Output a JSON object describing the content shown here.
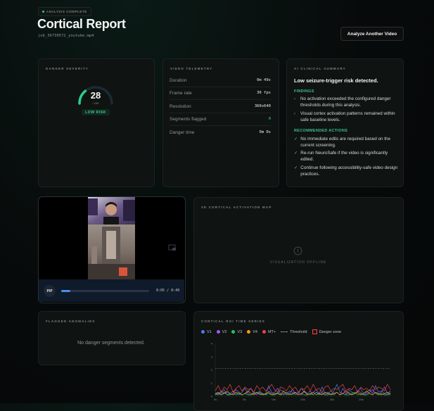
{
  "header": {
    "badge": "ANALYSIS COMPLETE",
    "title": "Cortical Report",
    "job_id": "job_36730572_youtube.mp4",
    "analyze_button": "Analyze Another Video"
  },
  "danger_severity": {
    "title": "DANGER SEVERITY",
    "score": "28",
    "score_max": "/ 100",
    "score_fraction": 0.28,
    "risk_label": "LOW RISK"
  },
  "telemetry": {
    "title": "VIDEO TELEMETRY",
    "rows": [
      {
        "label": "Duration",
        "value": "0m 49s"
      },
      {
        "label": "Frame rate",
        "value": "30 fps"
      },
      {
        "label": "Resolution",
        "value": "360x640"
      },
      {
        "label": "Segments flagged",
        "value": "0"
      },
      {
        "label": "Danger time",
        "value": "0m 0s"
      }
    ]
  },
  "ai_summary": {
    "title": "AI CLINICAL SUMMARY",
    "headline": "Low seizure-trigger risk detected.",
    "findings_title": "FINDINGS",
    "findings": [
      "No activation exceeded the configured danger thresholds during this analysis.",
      "Visual cortex activation patterns remained within safe baseline levels."
    ],
    "actions_title": "RECOMMENDED ACTIONS",
    "actions": [
      "No immediate edits are required based on the current screening.",
      "Re-run NeuroSafe if the video is significantly edited.",
      "Continue following accessibility-safe video design practices."
    ]
  },
  "player": {
    "play_pause": "P/P",
    "time": "0:05 / 0:49",
    "progress": 0.1
  },
  "activation_map": {
    "title": "3D CORTICAL ACTIVATION MAP",
    "status": "VISUALIZATION OFFLINE"
  },
  "anomalies": {
    "title": "FLAGGED ANOMALIES",
    "empty": "No danger segments detected."
  },
  "timeseries": {
    "title": "CORTICAL ROI TIME SERIES",
    "legend": [
      {
        "name": "V1",
        "color": "#4f7cf0"
      },
      {
        "name": "V2",
        "color": "#a855f7"
      },
      {
        "name": "V3",
        "color": "#22c55e"
      },
      {
        "name": "V4",
        "color": "#f59e0b"
      },
      {
        "name": "MT+",
        "color": "#ef4444"
      }
    ],
    "threshold_label": "Threshold",
    "danger_label": "Danger zone"
  },
  "chart_data": {
    "type": "line",
    "x_ticks": [
      "0s",
      "5s",
      "10s",
      "15s",
      "20s",
      "25s"
    ],
    "y_ticks": [
      "0",
      "1",
      "2",
      "3",
      "4"
    ],
    "ylim": [
      0,
      4
    ],
    "threshold": 2.1,
    "series": [
      {
        "name": "V1",
        "values": [
          0.1,
          0.3,
          0.2,
          0.5,
          0.1,
          0.2,
          0.4,
          0.2,
          0.1,
          0.3,
          0.6,
          0.2,
          0.1,
          0.3,
          0.2,
          0.4,
          0.1,
          0.2,
          0.8,
          0.3,
          0.1,
          0.2,
          0.5,
          0.3,
          0.2,
          0.4,
          0.3,
          0.1,
          0.2,
          0.6,
          0.3,
          0.2,
          0.4,
          0.1,
          0.3,
          0.2,
          0.7,
          0.2,
          0.3,
          0.1,
          0.4,
          0.9,
          0.3,
          0.2,
          0.1,
          0.5,
          0.3,
          0.2,
          0.4,
          0.6,
          0.2,
          0.3,
          0.5,
          0.2,
          0.8,
          0.3,
          0.4,
          0.2,
          0.1,
          0.3
        ]
      },
      {
        "name": "V2",
        "values": [
          0.2,
          0.1,
          0.4,
          0.2,
          0.3,
          0.1,
          0.2,
          0.5,
          0.3,
          0.1,
          0.2,
          0.3,
          0.6,
          0.2,
          0.1,
          0.3,
          0.2,
          0.1,
          0.4,
          0.2,
          0.3,
          0.6,
          0.2,
          0.1,
          0.3,
          0.2,
          0.5,
          0.2,
          0.3,
          0.1,
          0.4,
          0.2,
          0.1,
          0.3,
          0.5,
          0.2,
          0.3,
          0.1,
          0.2,
          0.4,
          0.2,
          0.3,
          0.1,
          0.6,
          0.2,
          0.3,
          0.1,
          0.2,
          0.4,
          0.3,
          0.1,
          0.2,
          0.3,
          0.5,
          0.2,
          0.1,
          0.3,
          0.7,
          0.2,
          0.4
        ]
      },
      {
        "name": "V3",
        "values": [
          0.1,
          0.2,
          0.1,
          0.3,
          0.1,
          0.1,
          0.2,
          0.1,
          0.3,
          0.1,
          0.2,
          0.1,
          0.1,
          0.2,
          0.3,
          0.1,
          0.2,
          0.1,
          0.2,
          0.1,
          0.1,
          0.3,
          0.1,
          0.2,
          0.1,
          0.2,
          0.1,
          0.3,
          0.1,
          0.2,
          0.1,
          0.1,
          0.2,
          0.1,
          0.3,
          0.1,
          0.2,
          0.1,
          0.1,
          0.2,
          0.1,
          0.3,
          0.1,
          0.2,
          0.1,
          0.1,
          0.2,
          0.3,
          0.1,
          0.2,
          0.1,
          0.1,
          0.2,
          0.1,
          0.3,
          0.1,
          0.2,
          0.1,
          0.1,
          0.2
        ]
      },
      {
        "name": "V4",
        "values": [
          0.2,
          0.3,
          0.1,
          0.2,
          0.4,
          0.2,
          0.1,
          0.3,
          0.2,
          0.1,
          0.2,
          0.4,
          0.2,
          0.1,
          0.3,
          0.2,
          0.1,
          0.2,
          0.3,
          0.1,
          0.2,
          0.2,
          0.1,
          0.4,
          0.2,
          0.1,
          0.2,
          0.3,
          0.1,
          0.2,
          0.4,
          0.1,
          0.2,
          0.3,
          0.1,
          0.2,
          0.1,
          0.3,
          0.2,
          0.1,
          0.2,
          0.3,
          0.1,
          0.2,
          0.4,
          0.2,
          0.1,
          0.2,
          0.3,
          0.1,
          0.2,
          0.4,
          0.2,
          0.1,
          0.3,
          0.2,
          0.1,
          0.2,
          0.3,
          0.1
        ]
      },
      {
        "name": "MT+",
        "values": [
          0.4,
          0.8,
          0.3,
          0.7,
          0.5,
          0.9,
          0.3,
          0.6,
          0.8,
          0.4,
          0.7,
          0.5,
          0.6,
          0.3,
          0.8,
          0.5,
          0.7,
          0.4,
          0.6,
          0.9,
          0.5,
          0.3,
          0.7,
          0.6,
          0.4,
          0.8,
          0.5,
          0.7,
          0.3,
          0.6,
          0.5,
          0.8,
          0.4,
          0.9,
          0.5,
          0.6,
          0.3,
          0.7,
          0.8,
          0.4,
          0.6,
          0.5,
          0.7,
          0.9,
          0.4,
          0.6,
          0.5,
          0.8,
          0.3,
          0.7,
          0.5,
          0.6,
          0.4,
          0.8,
          0.5,
          0.7,
          0.6,
          0.4,
          0.9,
          0.5
        ]
      }
    ]
  }
}
